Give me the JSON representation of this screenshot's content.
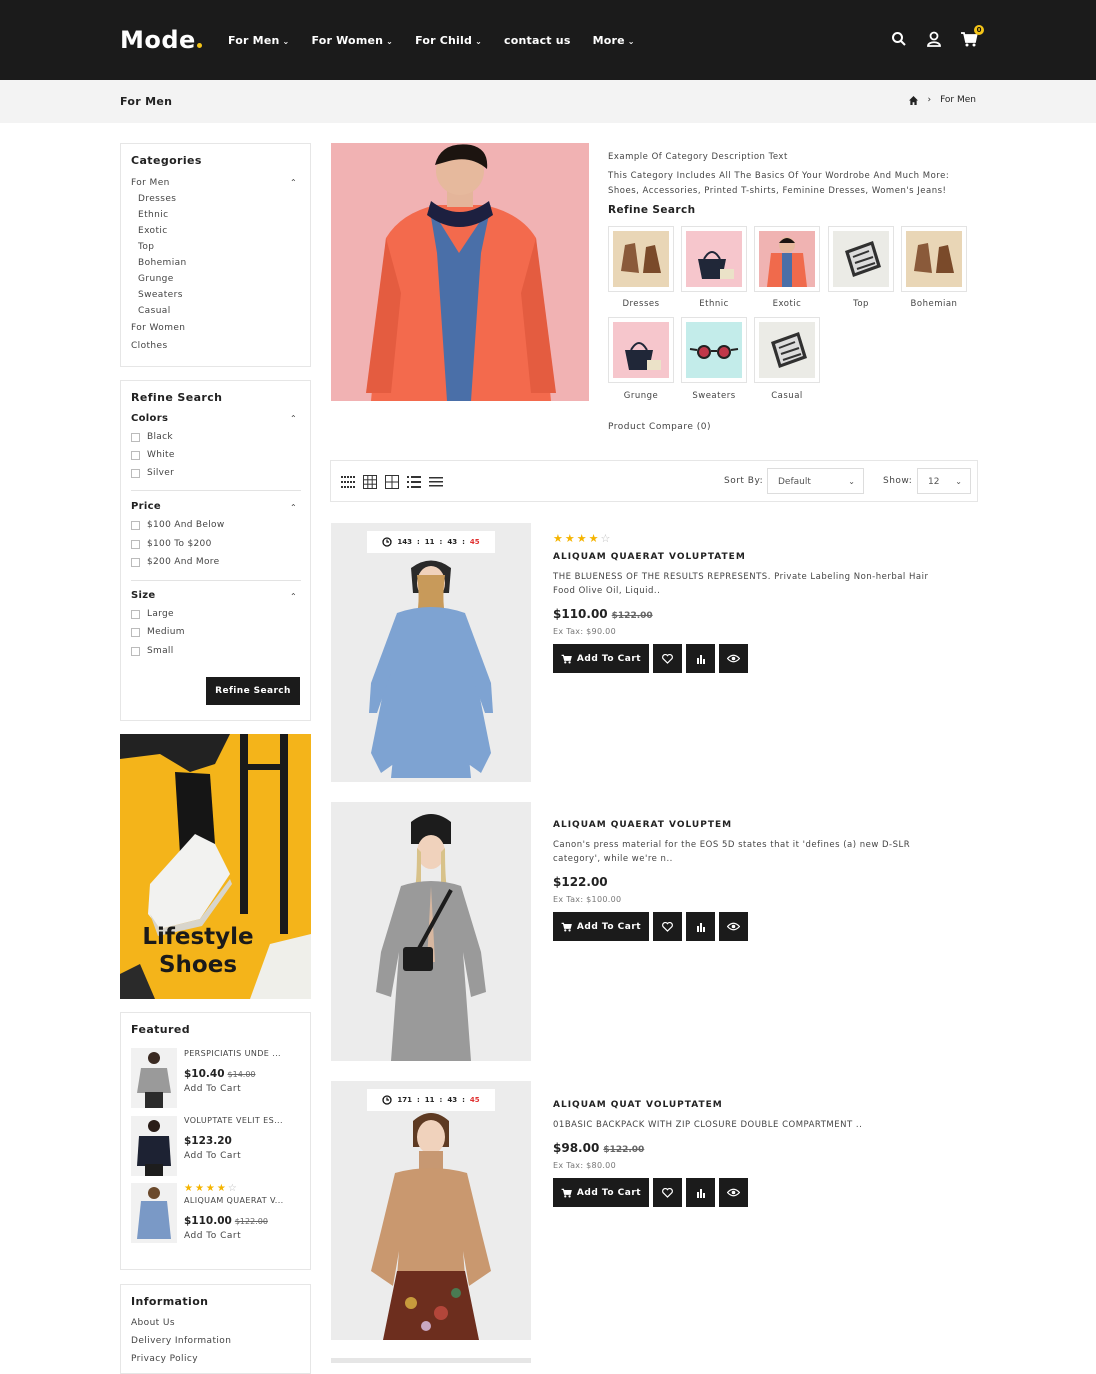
{
  "header": {
    "logo": "Mode",
    "nav": [
      {
        "label": "For Men",
        "dropdown": true
      },
      {
        "label": "For Women",
        "dropdown": true
      },
      {
        "label": "For Child",
        "dropdown": true
      },
      {
        "label": "contact us",
        "dropdown": false
      },
      {
        "label": "More",
        "dropdown": true
      }
    ],
    "cart_count": "0"
  },
  "breadcrumb": {
    "title": "For Men",
    "current": "For Men"
  },
  "categories": {
    "title": "Categories",
    "parent": "For Men",
    "items": [
      "Dresses",
      "Ethnic",
      "Exotic",
      "Top",
      "Bohemian",
      "Grunge",
      "Sweaters",
      "Casual"
    ],
    "others": [
      "For Women",
      "Clothes"
    ]
  },
  "refine": {
    "title": "Refine Search",
    "colors_title": "Colors",
    "colors": [
      "Black",
      "White",
      "Silver"
    ],
    "price_title": "Price",
    "prices": [
      "$100 And Below",
      "$100 To $200",
      "$200 And More"
    ],
    "size_title": "Size",
    "sizes": [
      "Large",
      "Medium",
      "Small"
    ],
    "button": "Refine Search"
  },
  "banner": {
    "line1": "Lifestyle",
    "line2": "Shoes",
    "bg": "#f4b41a"
  },
  "featured": {
    "title": "Featured",
    "items": [
      {
        "name": "PERSPICIATIS UNDE ...",
        "price": "$10.40",
        "old": "$14.00",
        "add": "Add To Cart"
      },
      {
        "name": "VOLUPTATE VELIT ES...",
        "price": "$123.20",
        "old": "",
        "add": "Add To Cart"
      },
      {
        "name": "ALIQUAM QUAERAT V...",
        "price": "$110.00",
        "old": "$122.00",
        "add": "Add To Cart",
        "rating": 4
      }
    ]
  },
  "information": {
    "title": "Information",
    "links": [
      "About Us",
      "Delivery Information",
      "Privacy Policy"
    ]
  },
  "category_desc": {
    "line1": "Example Of Category Description Text",
    "line2": "This Category Includes All The Basics Of Your Wordrobe And Much More:",
    "line3": "Shoes, Accessories, Printed T-shirts, Feminine Dresses, Women's Jeans!",
    "refine_title": "Refine Search",
    "thumbs": [
      "Dresses",
      "Ethnic",
      "Exotic",
      "Top",
      "Bohemian",
      "Grunge",
      "Sweaters",
      "Casual"
    ],
    "compare": "Product Compare (0)"
  },
  "toolbar": {
    "sort_label": "Sort By:",
    "sort_value": "Default",
    "show_label": "Show:",
    "show_value": "12"
  },
  "products": [
    {
      "timer": {
        "d": "143",
        "h": "11",
        "m": "43",
        "s": "45"
      },
      "rating": 4,
      "name": "ALIQUAM QUAERAT VOLUPTATEM",
      "desc": "THE BLUENESS OF THE RESULTS REPRESENTS. Private Labeling Non-herbal Hair Food Olive Oil, Liquid..",
      "price": "$110.00",
      "old": "$122.00",
      "tax": "Ex Tax: $90.00",
      "cart_label": "Add To Cart"
    },
    {
      "name": "ALIQUAM QUAERAT VOLUPTEM",
      "desc": "Canon's press material for the EOS 5D states that it 'defines (a) new D-SLR category', while we're n..",
      "price": "$122.00",
      "old": "",
      "tax": "Ex Tax: $100.00",
      "cart_label": "Add To Cart"
    },
    {
      "timer": {
        "d": "171",
        "h": "11",
        "m": "43",
        "s": "45"
      },
      "name": "ALIQUAM QUAT VOLUPTATEM",
      "desc": "01BASIC BACKPACK WITH ZIP CLOSURE DOUBLE COMPARTMENT ..",
      "price": "$98.00",
      "old": "$122.00",
      "tax": "Ex Tax: $80.00",
      "cart_label": "Add To Cart"
    }
  ],
  "colors": {
    "dark": "#1b1b1b",
    "accent": "#f5c518",
    "star": "#f5b400",
    "timer_red": "#e03030"
  }
}
